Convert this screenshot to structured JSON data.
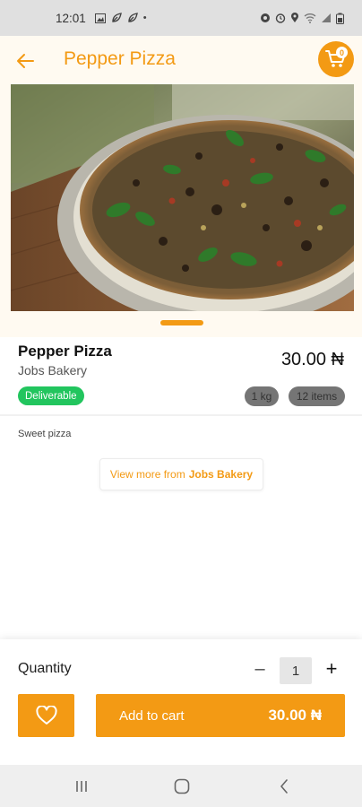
{
  "status_bar": {
    "time": "12:01",
    "dot": "•"
  },
  "header": {
    "title": "Pepper Pizza",
    "cart_count": "0"
  },
  "product": {
    "name": "Pepper Pizza",
    "vendor": "Jobs Bakery",
    "price": "30.00 ₦",
    "deliverable": "Deliverable",
    "weight": "1 kg",
    "items": "12 items",
    "description": "Sweet pizza"
  },
  "view_more": {
    "prefix": "View more from",
    "vendor": "Jobs Bakery"
  },
  "quantity": {
    "label": "Quantity",
    "minus": "–",
    "value": "1",
    "plus": "+"
  },
  "cart_button": {
    "label": "Add to cart",
    "price": "30.00 ₦"
  },
  "colors": {
    "accent": "#f39a14",
    "deliverable": "#22c55e",
    "chip": "#757575"
  },
  "icons": [
    "back-arrow-icon",
    "cart-icon",
    "heart-icon",
    "recents-icon",
    "home-icon",
    "back-icon"
  ]
}
